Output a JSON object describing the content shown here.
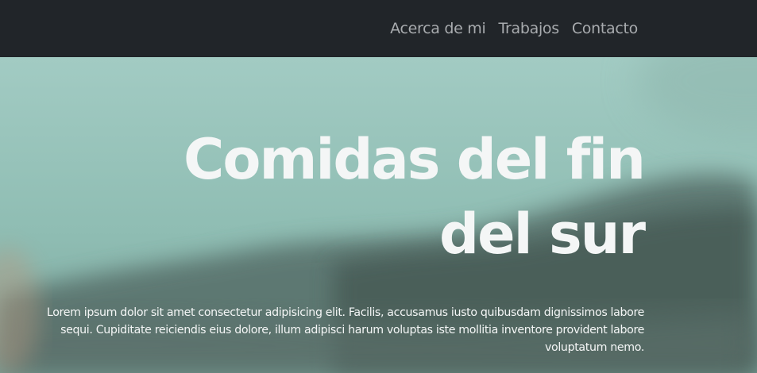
{
  "nav": {
    "items": [
      {
        "label": "Acerca de mi"
      },
      {
        "label": "Trabajos"
      },
      {
        "label": "Contacto"
      }
    ]
  },
  "hero": {
    "title": "Comidas del fin del sur",
    "text": "Lorem ipsum dolor sit amet consectetur adipisicing elit. Facilis, accusamus iusto quibusdam dignissimos labore sequi. Cupiditate reiciendis eius dolore, illum adipisci harum voluptas iste mollitia inventore provident labore voluptatum nemo."
  },
  "colors": {
    "navbar_bg": "#212529",
    "nav_link": "#a8abae",
    "hero_text": "#f4f6f6",
    "sky": "#9ec9bf",
    "mountain": "#4f6460"
  }
}
